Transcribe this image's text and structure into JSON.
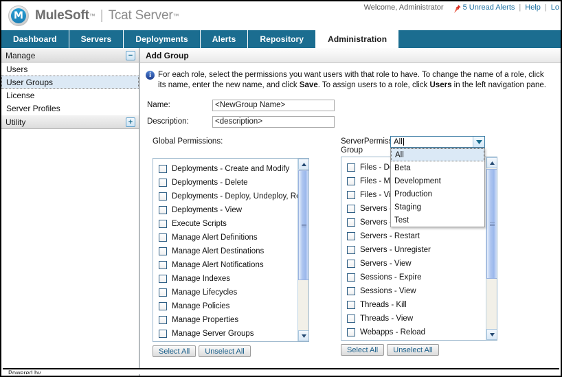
{
  "header": {
    "brand": "MuleSoft",
    "brand_tm": "™",
    "separator": "|",
    "product": "Tcat Server",
    "product_tm": "™",
    "welcome": "Welcome, Administrator",
    "alerts_label": "5 Unread Alerts",
    "alerts_icon": "pushpin-icon",
    "help_label": "Help",
    "logout_label": "Lo",
    "sep": "|",
    "link_color": "#1a6ea0"
  },
  "tabs": [
    {
      "label": "Dashboard",
      "active": false
    },
    {
      "label": "Servers",
      "active": false
    },
    {
      "label": "Deployments",
      "active": false
    },
    {
      "label": "Alerts",
      "active": false
    },
    {
      "label": "Repository",
      "active": false
    },
    {
      "label": "Administration",
      "active": true
    }
  ],
  "tab_bar_color": "#1b6d90",
  "sidebar": {
    "sections": [
      {
        "title": "Manage",
        "toggle": "−",
        "toggle_icon": "minus-icon",
        "items": [
          {
            "label": "Users",
            "selected": false
          },
          {
            "label": "User Groups",
            "selected": true
          },
          {
            "label": "License",
            "selected": false
          },
          {
            "label": "Server Profiles",
            "selected": false
          }
        ]
      },
      {
        "title": "Utility",
        "toggle": "+",
        "toggle_icon": "plus-icon",
        "items": []
      }
    ]
  },
  "content": {
    "title": "Add Group",
    "info": {
      "icon": "info-icon",
      "line1_a": "For each role, select the permissions you want users with that role to have. To change the name of a role, click its name,",
      "line2_a": "enter the new name, and click ",
      "line2_b": "Save",
      "line2_c": ". To assign users to a role, click ",
      "line2_d": "Users",
      "line2_e": " in the left navigation pane."
    },
    "form": {
      "name_label": "Name:",
      "name_value": "<NewGroup Name>",
      "description_label": "Description:",
      "description_value": "<description>"
    },
    "global_panel": {
      "label": "Global Permissions:",
      "permissions": [
        "Deployments - Create and Modify",
        "Deployments - Delete",
        "Deployments - Deploy, Undeploy, Redep",
        "Deployments - View",
        "Execute Scripts",
        "Manage Alert Definitions",
        "Manage Alert Destinations",
        "Manage Alert Notifications",
        "Manage Indexes",
        "Manage Lifecycles",
        "Manage Policies",
        "Manage Properties",
        "Manage Server Groups"
      ],
      "select_all": "Select All",
      "unselect_all": "Unselect All"
    },
    "server_group_panel": {
      "label_line1": "Server Group",
      "label_line2": "Permissions:",
      "combo_value": "All",
      "combo_arrow_icon": "chevron-down-icon",
      "combo_options": [
        {
          "label": "All",
          "selected": true
        },
        {
          "label": "Beta",
          "selected": false
        },
        {
          "label": "Development",
          "selected": false
        },
        {
          "label": "Production",
          "selected": false
        },
        {
          "label": "Staging",
          "selected": false
        },
        {
          "label": "Test",
          "selected": false
        }
      ],
      "permissions": [
        "Files - Dele",
        "Files - Mod",
        "Files - View",
        "Servers - ",
        "Servers - ",
        "Servers - Restart",
        "Servers - Unregister",
        "Servers - View",
        "Sessions - Expire",
        "Sessions - View",
        "Threads - Kill",
        "Threads - View",
        "Webapps - Reload"
      ],
      "select_all": "Select All",
      "unselect_all": "Unselect All"
    }
  },
  "footer": {
    "text": "Powered by"
  }
}
